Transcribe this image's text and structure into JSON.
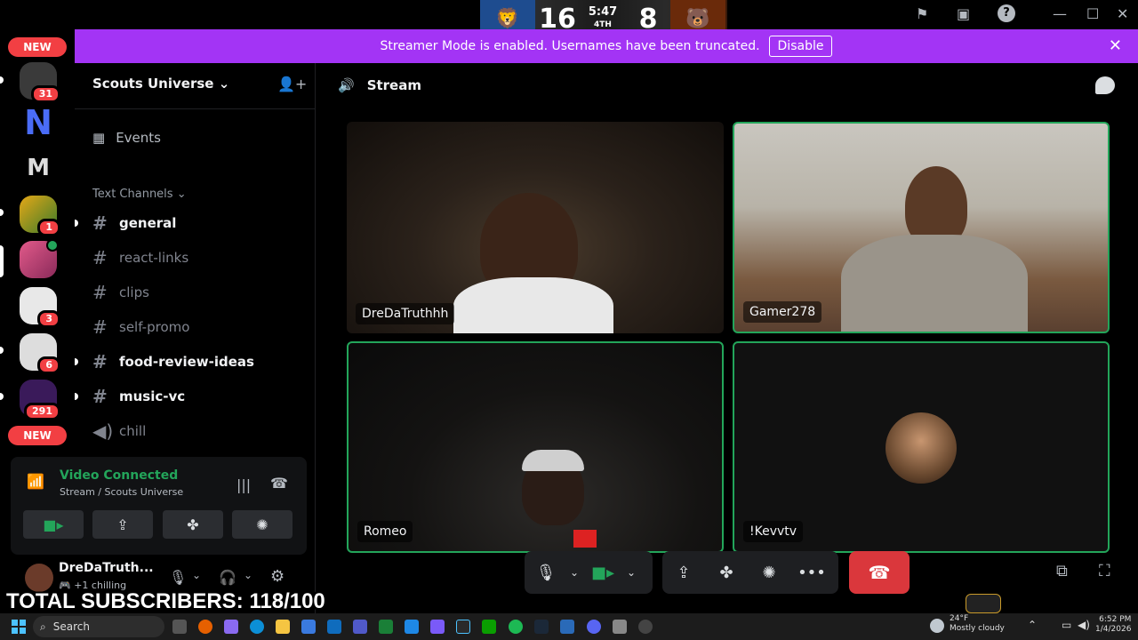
{
  "rail": {
    "new_label_top": "NEW",
    "new_label_bottom": "NEW",
    "servers": [
      {
        "badge": "31",
        "letter": ""
      },
      {
        "badge": "",
        "letter": "N"
      },
      {
        "badge": "",
        "letter": "M"
      },
      {
        "badge": "1",
        "letter": ""
      },
      {
        "badge": "",
        "letter": ""
      },
      {
        "badge": "3",
        "letter": ""
      },
      {
        "badge": "6",
        "letter": ""
      },
      {
        "badge": "291",
        "letter": ""
      }
    ]
  },
  "scoreboard": {
    "home_score": "16",
    "clock": "5:47",
    "quarter": "4TH",
    "away_score": "8"
  },
  "banner": {
    "message": "Streamer Mode is enabled. Usernames have been truncated.",
    "button": "Disable"
  },
  "sidebar": {
    "guild_name": "Scouts Universe",
    "events_label": "Events",
    "category": "Text Channels",
    "channels": [
      {
        "name": "general",
        "unread": true
      },
      {
        "name": "react-links",
        "unread": false
      },
      {
        "name": "clips",
        "unread": false
      },
      {
        "name": "self-promo",
        "unread": false
      },
      {
        "name": "food-review-ideas",
        "unread": true
      },
      {
        "name": "music-vc",
        "unread": true
      },
      {
        "name": "chill",
        "unread": false
      }
    ]
  },
  "voice": {
    "status": "Video Connected",
    "location": "Stream / Scouts Universe"
  },
  "user": {
    "name": "DreDaTruth...",
    "status": "chilling",
    "plus": "+1"
  },
  "main": {
    "channel_title": "Stream",
    "tiles": [
      {
        "name": "DreDaTruthhh"
      },
      {
        "name": "Gamer278"
      },
      {
        "name": "Romeo"
      },
      {
        "name": "!Kevvtv"
      }
    ]
  },
  "overlay": {
    "subscribers": "TOTAL SUBSCRIBERS: 118/100"
  },
  "taskbar": {
    "search": "Search",
    "temperature": "24°F",
    "weather": "Mostly cloudy",
    "time": "6:52 PM",
    "date": "1/4/2026"
  },
  "colors": {
    "banner": "#a334f5",
    "connected": "#23a55a",
    "danger": "#da373c",
    "badge": "#f23f43"
  }
}
